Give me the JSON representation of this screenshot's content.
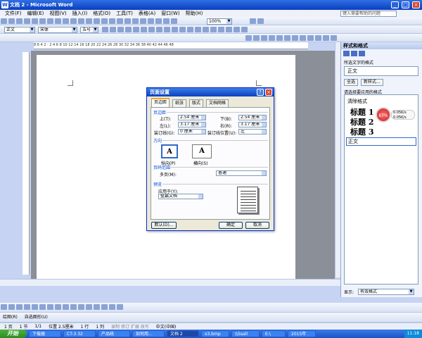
{
  "window": {
    "title": "文档 2 - Microsoft Word",
    "icon_letter": "W"
  },
  "menu": [
    "文件(F)",
    "编辑(E)",
    "视图(V)",
    "插入(I)",
    "格式(O)",
    "工具(T)",
    "表格(A)",
    "窗口(W)",
    "帮助(H)"
  ],
  "help_box": {
    "placeholder": "键入需要帮助的问题"
  },
  "toolbar": {
    "zoom": "100%",
    "style": "正文",
    "font": "宋体",
    "size": "五号"
  },
  "ruler": {
    "ticks": "8 6 4 2 · 2 4 6 8 10 12 14 16 18 20 22 24 26 28 30 32 34 36 38 40 42 44 46 48"
  },
  "task_pane": {
    "title": "样式和格式",
    "selected_label": "所选文字的格式",
    "selected_value": "正文",
    "btn_select_all": "全选",
    "btn_new_style": "新样式...",
    "apply_label": "请选择要应用的格式",
    "clear_format": "清除格式",
    "styles": [
      "标题 1",
      "标题 2",
      "标题 3"
    ],
    "normal": "正文",
    "show_label": "显示:",
    "show_value": "有效格式"
  },
  "net_monitor": {
    "percent": "87%",
    "up": "0.05K/s",
    "down": "0.05K/s"
  },
  "dialog": {
    "title": "页面设置",
    "help_icon": "?",
    "tabs": [
      "页边距",
      "纸张",
      "版式",
      "文档网格"
    ],
    "margins_section": "页边距",
    "top_label": "上(T):",
    "top_value": "2.54 厘米",
    "bottom_label": "下(B):",
    "bottom_value": "2.54 厘米",
    "left_label": "左(L):",
    "left_value": "3.17 厘米",
    "right_label": "右(R):",
    "right_value": "3.17 厘米",
    "gutter_label": "装订线(G):",
    "gutter_value": "0 厘米",
    "gutter_pos_label": "装订线位置(U):",
    "gutter_pos_value": "左",
    "orientation_section": "方向",
    "portrait": "纵向(P)",
    "landscape": "横向(S)",
    "pages_section": "页码范围",
    "multi_pages_label": "多页(M):",
    "multi_pages_value": "普通",
    "preview_section": "预览",
    "apply_to_label": "应用于(Y):",
    "apply_to_value": "整篇文档",
    "btn_default": "默认(D)...",
    "btn_ok": "确定",
    "btn_cancel": "取消"
  },
  "status": {
    "page": "1 页",
    "section": "1 节",
    "pages": "1/1",
    "position": "位置 2.5厘米",
    "line": "1 行",
    "col": "1 列",
    "flags": "录制 修订 扩展 改写",
    "lang": "中文(中国)"
  },
  "drawing_bar": {
    "draw": "绘图(R)",
    "autoshapes": "自选图形(U)"
  },
  "taskbar": {
    "start": "开始",
    "items": [
      "下载器",
      "CT-3 32",
      "产品统",
      "如何用...",
      "文档 2",
      "x3.bmp",
      "\\\\Ssall",
      "E:\\",
      "2015年"
    ],
    "clock": "11:18"
  }
}
